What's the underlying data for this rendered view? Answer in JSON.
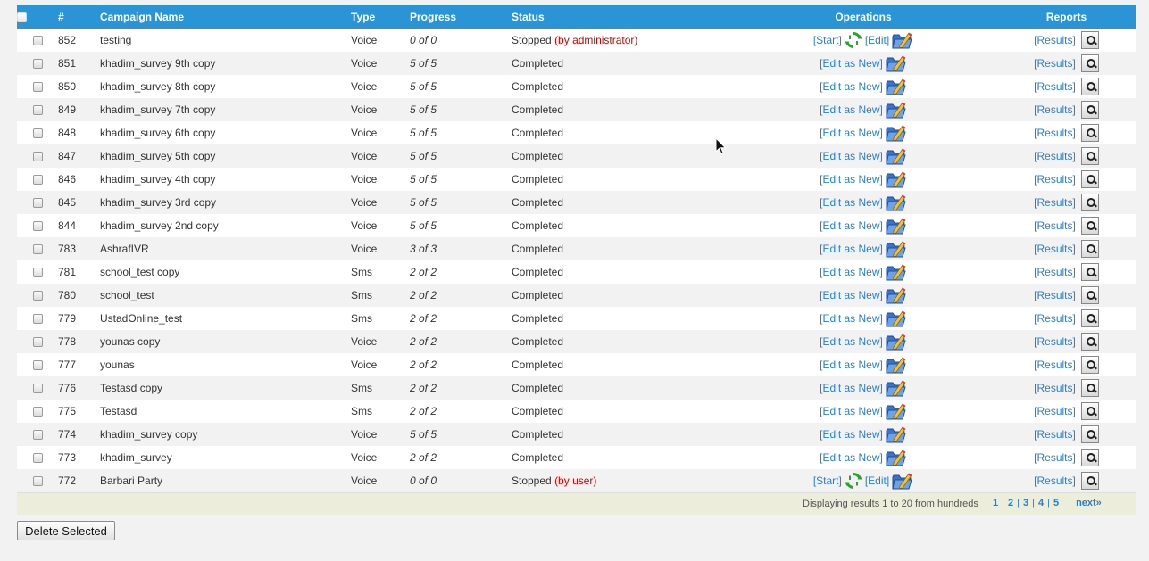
{
  "headers": {
    "num": "#",
    "name": "Campaign Name",
    "type": "Type",
    "progress": "Progress",
    "status": "Status",
    "operations": "Operations",
    "reports": "Reports"
  },
  "labels": {
    "start": "[Start]",
    "edit": "[Edit]",
    "edit_as_new": "[Edit as New]",
    "results": "[Results]",
    "status_stopped": "Stopped",
    "status_completed": "Completed"
  },
  "rows": [
    {
      "num": "852",
      "name": "testing",
      "type": "Voice",
      "progress": "0 of 0",
      "status": "Stopped",
      "status_by": "(by administrator)",
      "state": "stopped"
    },
    {
      "num": "851",
      "name": "khadim_survey 9th copy",
      "type": "Voice",
      "progress": "5 of 5",
      "status": "Completed",
      "status_by": "",
      "state": "completed"
    },
    {
      "num": "850",
      "name": "khadim_survey 8th copy",
      "type": "Voice",
      "progress": "5 of 5",
      "status": "Completed",
      "status_by": "",
      "state": "completed"
    },
    {
      "num": "849",
      "name": "khadim_survey 7th copy",
      "type": "Voice",
      "progress": "5 of 5",
      "status": "Completed",
      "status_by": "",
      "state": "completed"
    },
    {
      "num": "848",
      "name": "khadim_survey 6th copy",
      "type": "Voice",
      "progress": "5 of 5",
      "status": "Completed",
      "status_by": "",
      "state": "completed"
    },
    {
      "num": "847",
      "name": "khadim_survey 5th copy",
      "type": "Voice",
      "progress": "5 of 5",
      "status": "Completed",
      "status_by": "",
      "state": "completed"
    },
    {
      "num": "846",
      "name": "khadim_survey 4th copy",
      "type": "Voice",
      "progress": "5 of 5",
      "status": "Completed",
      "status_by": "",
      "state": "completed"
    },
    {
      "num": "845",
      "name": "khadim_survey 3rd copy",
      "type": "Voice",
      "progress": "5 of 5",
      "status": "Completed",
      "status_by": "",
      "state": "completed"
    },
    {
      "num": "844",
      "name": "khadim_survey 2nd copy",
      "type": "Voice",
      "progress": "5 of 5",
      "status": "Completed",
      "status_by": "",
      "state": "completed"
    },
    {
      "num": "783",
      "name": "AshrafIVR",
      "type": "Voice",
      "progress": "3 of 3",
      "status": "Completed",
      "status_by": "",
      "state": "completed"
    },
    {
      "num": "781",
      "name": "school_test copy",
      "type": "Sms",
      "progress": "2 of 2",
      "status": "Completed",
      "status_by": "",
      "state": "completed"
    },
    {
      "num": "780",
      "name": "school_test",
      "type": "Sms",
      "progress": "2 of 2",
      "status": "Completed",
      "status_by": "",
      "state": "completed"
    },
    {
      "num": "779",
      "name": "UstadOnline_test",
      "type": "Sms",
      "progress": "2 of 2",
      "status": "Completed",
      "status_by": "",
      "state": "completed"
    },
    {
      "num": "778",
      "name": "younas copy",
      "type": "Voice",
      "progress": "2 of 2",
      "status": "Completed",
      "status_by": "",
      "state": "completed"
    },
    {
      "num": "777",
      "name": "younas",
      "type": "Voice",
      "progress": "2 of 2",
      "status": "Completed",
      "status_by": "",
      "state": "completed"
    },
    {
      "num": "776",
      "name": "Testasd copy",
      "type": "Sms",
      "progress": "2 of 2",
      "status": "Completed",
      "status_by": "",
      "state": "completed"
    },
    {
      "num": "775",
      "name": "Testasd",
      "type": "Sms",
      "progress": "2 of 2",
      "status": "Completed",
      "status_by": "",
      "state": "completed"
    },
    {
      "num": "774",
      "name": "khadim_survey copy",
      "type": "Voice",
      "progress": "5 of 5",
      "status": "Completed",
      "status_by": "",
      "state": "completed"
    },
    {
      "num": "773",
      "name": "khadim_survey",
      "type": "Voice",
      "progress": "2 of 2",
      "status": "Completed",
      "status_by": "",
      "state": "completed"
    },
    {
      "num": "772",
      "name": "Barbari Party",
      "type": "Voice",
      "progress": "0 of 0",
      "status": "Stopped",
      "status_by": "(by user)",
      "state": "stopped"
    }
  ],
  "footer": {
    "display_text": "Displaying results 1 to 20 from hundreds",
    "pages": [
      "1",
      "2",
      "3",
      "4",
      "5"
    ],
    "current_page": "1",
    "separator": "|",
    "next_label": "next»"
  },
  "actions": {
    "delete_selected": "Delete Selected"
  },
  "colors": {
    "header_bg": "#2a94d6",
    "link": "#2a7fc8",
    "status_by": "#d40000",
    "row_alt": "#f2f2f2",
    "footer_bg": "#ededdc"
  },
  "icons": {
    "select_all": "checkbox-icon",
    "start_refresh": "refresh-icon",
    "edit_folder": "folder-edit-icon",
    "report": "magnifier-report-icon"
  }
}
